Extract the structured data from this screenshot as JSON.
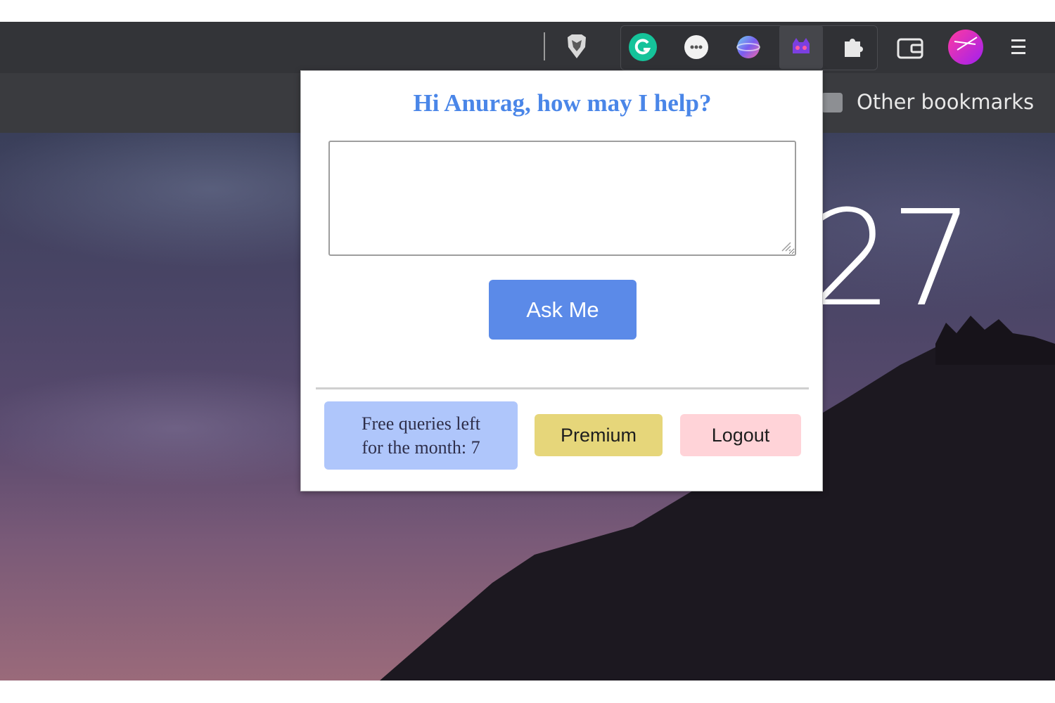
{
  "browser": {
    "toolbar_icons": [
      "brave-shield-icon",
      "grammarly-icon",
      "extension-chat-icon",
      "extension-globe-icon",
      "extension-ai-icon",
      "puzzle-icon",
      "wallet-icon",
      "profile-avatar-icon",
      "menu-icon"
    ],
    "bookmarks": {
      "other_bookmarks_label": "Other bookmarks"
    },
    "new_tab": {
      "clock_partial": "27"
    }
  },
  "popup": {
    "greeting": "Hi Anurag, how may I help?",
    "query_value": "",
    "ask_button_label": "Ask Me",
    "quota_line_1": "Free queries left",
    "quota_line_2": "for the month: 7",
    "premium_label": "Premium",
    "logout_label": "Logout"
  },
  "colors": {
    "greeting": "#4a86e8",
    "ask_button": "#5b8ae8",
    "quota_badge": "#afc6fb",
    "premium_button": "#e6d67a",
    "logout_button": "#ffd3d8",
    "toolbar": "#333438"
  }
}
